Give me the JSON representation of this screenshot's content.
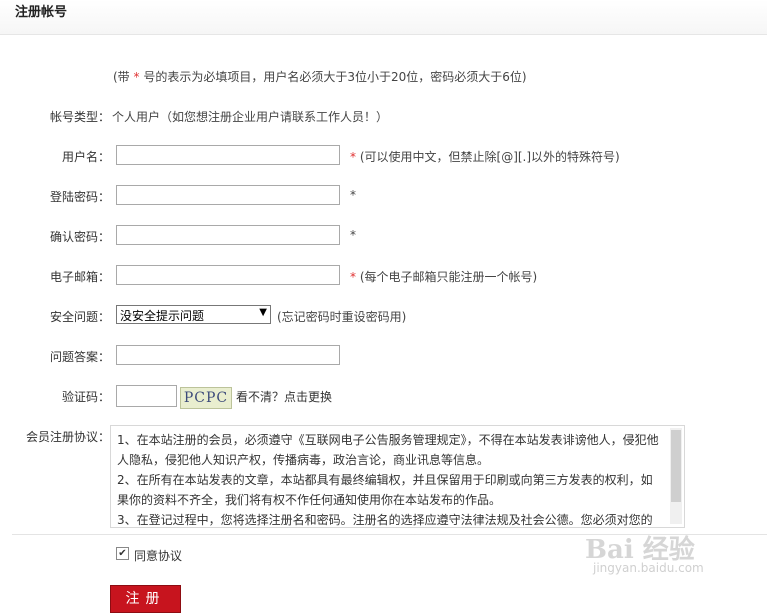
{
  "header": {
    "title": "注册帐号"
  },
  "note": {
    "prefix": "(带 ",
    "star": "*",
    "suffix": " 号的表示为必填项目，用户名必须大于3位小于20位，密码必须大于6位)"
  },
  "account_type": {
    "label": "帐号类型：",
    "value": "个人用户（如您想注册企业用户请联系工作人员！）"
  },
  "username": {
    "label": "用户名：",
    "star": "*",
    "hint": "(可以使用中文，但禁止除[@][.]以外的特殊符号)",
    "value": ""
  },
  "password": {
    "label": "登陆密码：",
    "star": "*",
    "value": ""
  },
  "confirm_password": {
    "label": "确认密码：",
    "star": "*",
    "value": ""
  },
  "email": {
    "label": "电子邮箱：",
    "star": "*",
    "hint": "(每个电子邮箱只能注册一个帐号)",
    "value": ""
  },
  "security_question": {
    "label": "安全问题：",
    "selected": "没安全提示问题",
    "hint": "(忘记密码时重设密码用)"
  },
  "security_answer": {
    "label": "问题答案：",
    "value": ""
  },
  "captcha": {
    "label": "验证码：",
    "image_text": "PCPC",
    "refresh_text": "看不清？点击更换",
    "value": ""
  },
  "agreement": {
    "label": "会员注册协议：",
    "paragraphs": [
      "1、在本站注册的会员，必须遵守《互联网电子公告服务管理规定》，不得在本站发表诽谤他人，侵犯他人隐私，侵犯他人知识产权，传播病毒，政治言论，商业讯息等信息。",
      "2、在所有在本站发表的文章，本站都具有最终编辑权，并且保留用于印刷或向第三方发表的权利，如果你的资料不齐全，我们将有权不作任何通知使用你在本站发布的作品。",
      "3、在登记过程中，您将选择注册名和密码。注册名的选择应遵守法律法规及社会公德。您必须对您的"
    ]
  },
  "agree": {
    "label": "同意协议",
    "checked": true
  },
  "submit": {
    "label": "注册"
  },
  "watermark": {
    "line1": "Bai 经验",
    "line2": "jingyan.baidu.com"
  }
}
